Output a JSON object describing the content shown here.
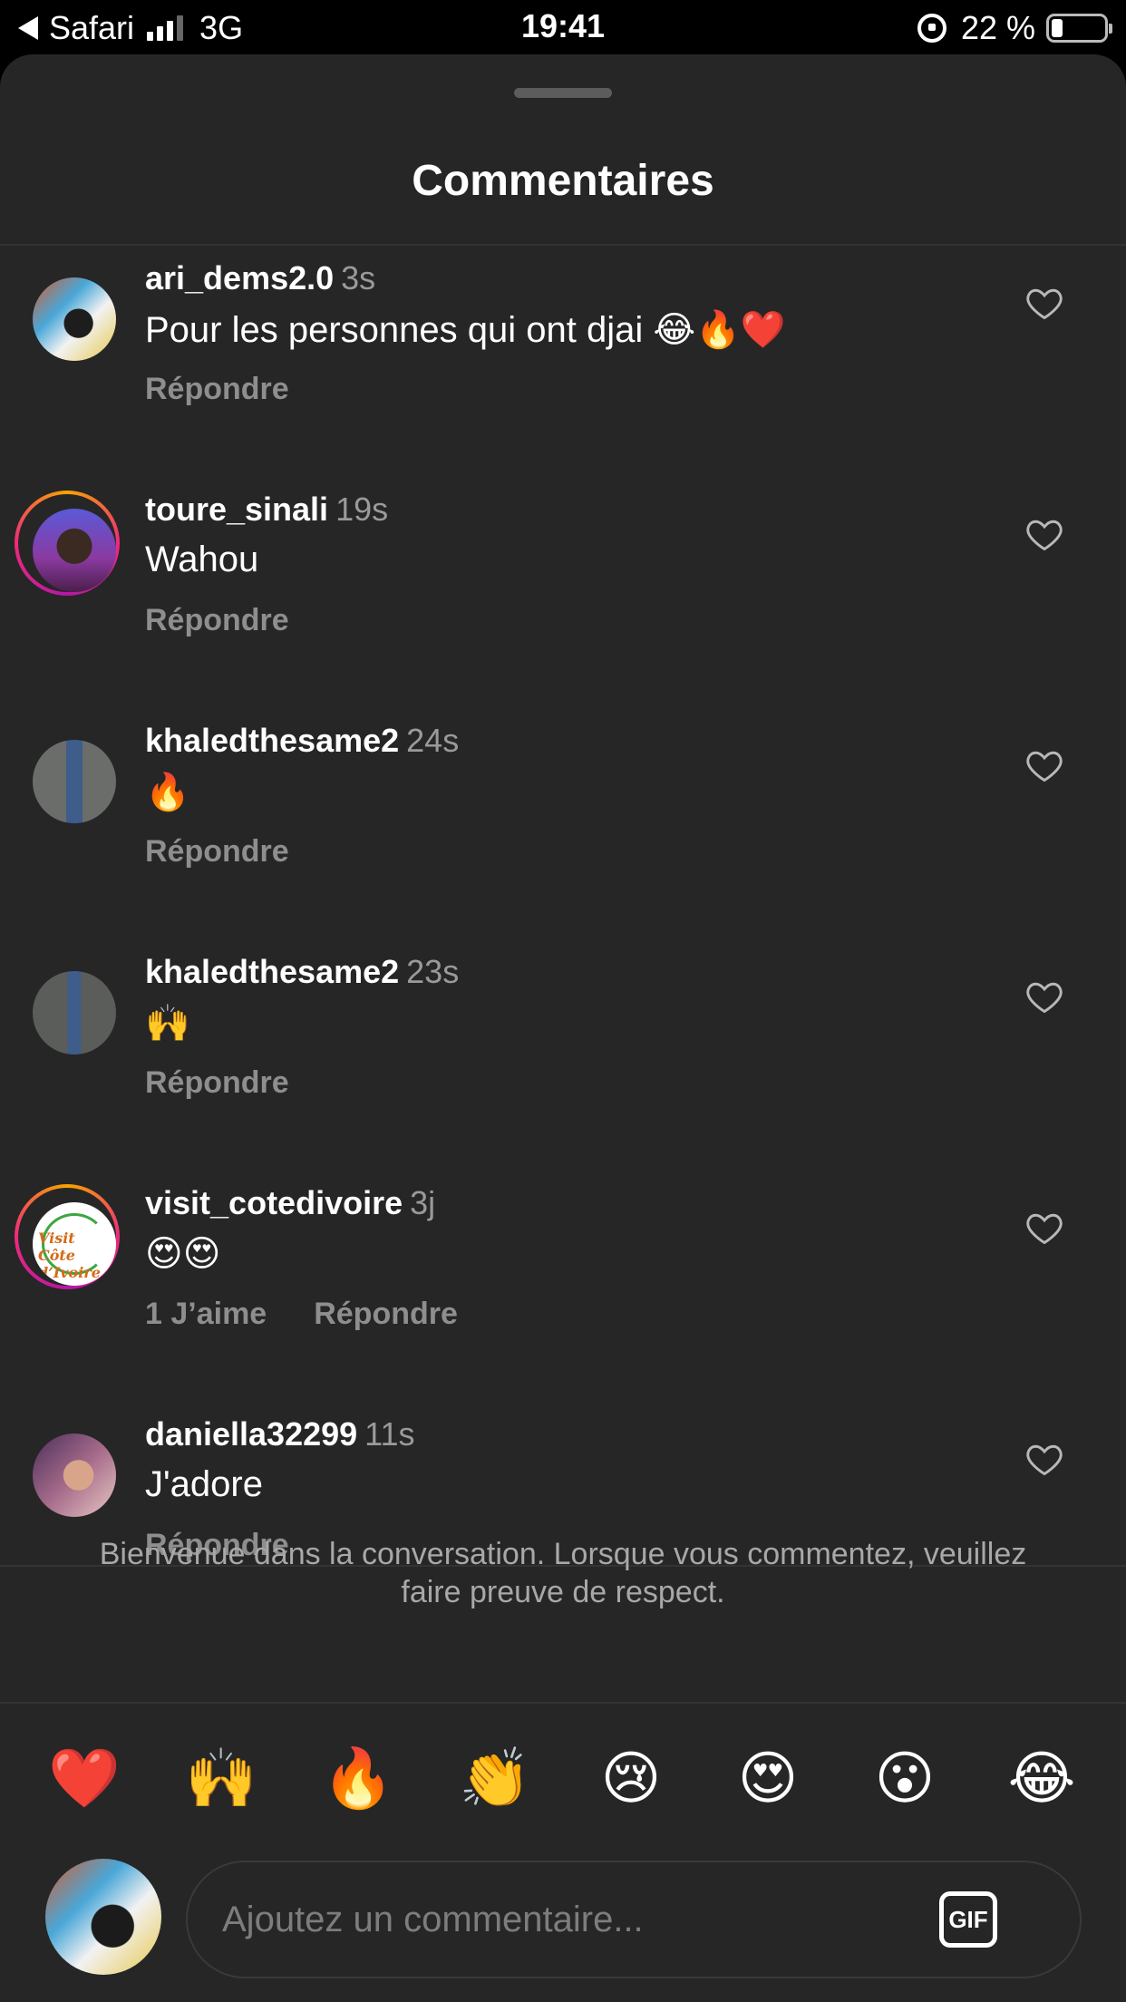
{
  "status_bar": {
    "back_app": "Safari",
    "network": "3G",
    "time": "19:41",
    "battery": "22 %",
    "battery_level": 0.22
  },
  "sheet": {
    "title": "Commentaires"
  },
  "comments": [
    {
      "username": "ari_dems2.0",
      "time": "3s",
      "text": "Pour les personnes qui ont djai 😂🔥❤️",
      "reply_label": "Répondre",
      "likes_label": "",
      "story_ring": false
    },
    {
      "username": "toure_sinali",
      "time": "19s",
      "text": "Wahou",
      "reply_label": "Répondre",
      "likes_label": "",
      "story_ring": true
    },
    {
      "username": "khaledthesame2",
      "time": "24s",
      "text": "🔥",
      "reply_label": "Répondre",
      "likes_label": "",
      "story_ring": false
    },
    {
      "username": "khaledthesame2",
      "time": "23s",
      "text": "🙌",
      "reply_label": "Répondre",
      "likes_label": "",
      "story_ring": false
    },
    {
      "username": "visit_cotedivoire",
      "time": "3j",
      "text": "😍😍",
      "reply_label": "Répondre",
      "likes_label": "1 J’aime",
      "story_ring": true,
      "avatar_logo_text": "Visit Côte d’Ivoire"
    },
    {
      "username": "daniella32299",
      "time": "11s",
      "text": "J'adore",
      "reply_label": "Répondre",
      "likes_label": "",
      "story_ring": false
    }
  ],
  "welcome_notice": "Bienvenue dans la conversation. Lorsque vous commentez, veuillez faire preuve de respect.",
  "quick_emojis": [
    "❤️",
    "🙌",
    "🔥",
    "👏",
    "😢",
    "😍",
    "😮",
    "😂"
  ],
  "composer": {
    "placeholder": "Ajoutez un commentaire...",
    "gif_label": "GIF"
  },
  "colors": {
    "background": "#262626",
    "secondary_text": "#8e8e8e",
    "ring_gradient": [
      "#f7a400",
      "#ee2a7b",
      "#b517a4"
    ]
  }
}
